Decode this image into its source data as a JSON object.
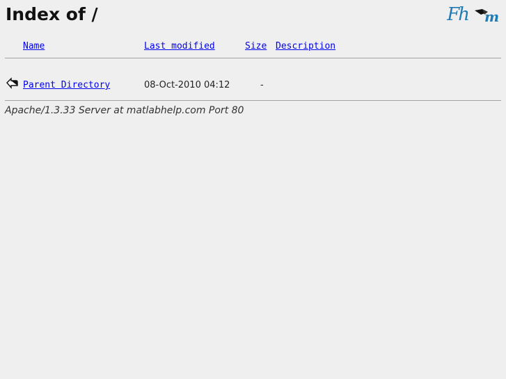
{
  "page": {
    "title": "Index of /",
    "logos": {
      "left_text": "Fh",
      "right_icon": "matlab-m-logo-icon"
    }
  },
  "table": {
    "headers": {
      "name": "Name",
      "modified": "Last modified",
      "size": "Size",
      "description": "Description"
    },
    "rows": [
      {
        "icon": "back-arrow-icon",
        "name": "Parent Directory",
        "modified": "08-Oct-2010 04:12",
        "size": "-",
        "description": ""
      }
    ]
  },
  "footer": {
    "text": "Apache/1.3.33 Server at matlabhelp.com Port 80"
  },
  "colors": {
    "link": "#0000ee",
    "background": "#efeff0",
    "logo_blue": "#1f7bb4"
  }
}
